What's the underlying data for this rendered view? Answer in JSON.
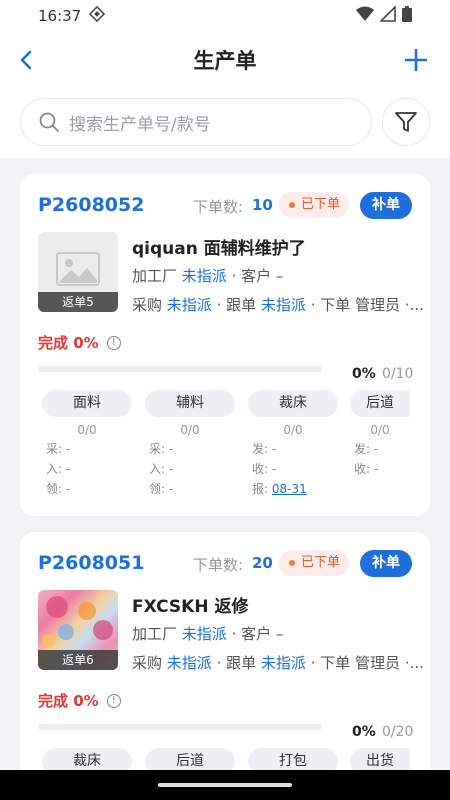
{
  "status_bar": {
    "time": "16:37"
  },
  "header": {
    "title": "生产单"
  },
  "search": {
    "placeholder": "搜索生产单号/款号"
  },
  "orders": [
    {
      "code": "P2608052",
      "qty_label": "下单数:",
      "qty": "10",
      "status": "已下单",
      "supplement_label": "补单",
      "return_badge": "返单5",
      "name": "qiquan 面辅料维护了",
      "factory_label": "加工厂",
      "factory_value": "未指派",
      "customer_text": "· 客户 –",
      "purchase_label": "采购",
      "purchase_value": "未指派",
      "follow_label": "· 跟单",
      "follow_value": "未指派",
      "order_text": "· 下单 管理员 ·...",
      "completion": "完成 0%",
      "progress_pct": "0%",
      "progress_total": "0/10",
      "progress_fraction": 0,
      "stages": [
        {
          "name": "面料",
          "count": "0/0",
          "meta1": "采: -",
          "meta2": "入: -",
          "meta3": "领: -"
        },
        {
          "name": "辅料",
          "count": "0/0",
          "meta1": "采: -",
          "meta2": "入: -",
          "meta3": "领: -"
        },
        {
          "name": "裁床",
          "count": "0/0",
          "meta1": "发: -",
          "meta2": "收: -",
          "meta3_label": "报:",
          "meta3_link": "08-31"
        },
        {
          "name": "后道",
          "count": "0/0",
          "meta1": "发: -",
          "meta2": "收: -"
        }
      ]
    },
    {
      "code": "P2608051",
      "qty_label": "下单数:",
      "qty": "20",
      "status": "已下单",
      "supplement_label": "补单",
      "return_badge": "返单6",
      "name": "FXCSKH 返修",
      "factory_label": "加工厂",
      "factory_value": "未指派",
      "customer_text": "· 客户 –",
      "purchase_label": "采购",
      "purchase_value": "未指派",
      "follow_label": "· 跟单",
      "follow_value": "未指派",
      "order_text": "· 下单 管理员 ·...",
      "completion": "完成 0%",
      "progress_pct": "0%",
      "progress_total": "0/20",
      "progress_fraction": 0,
      "stages": [
        {
          "name": "裁床"
        },
        {
          "name": "后道"
        },
        {
          "name": "打包"
        },
        {
          "name": "出货"
        }
      ]
    }
  ]
}
